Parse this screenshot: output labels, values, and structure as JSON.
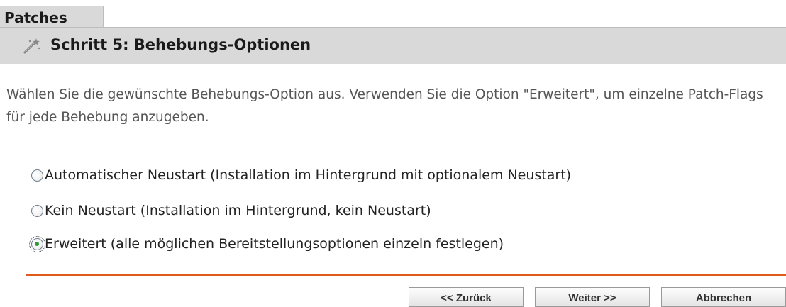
{
  "tab": {
    "label": "Patches"
  },
  "step": {
    "icon": "wizard-wand-icon",
    "title": "Schritt 5: Behebungs-Optionen"
  },
  "intro_text": "Wählen Sie die gewünschte Behebungs-Option aus. Verwenden Sie die Option \"Erweitert\", um einzelne Patch-Flags für jede Behebung anzugeben.",
  "options": [
    {
      "label": "Automatischer Neustart (Installation im Hintergrund mit optionalem Neustart)",
      "checked": false
    },
    {
      "label": "Kein Neustart (Installation im Hintergrund, kein Neustart)",
      "checked": false
    },
    {
      "label": "Erweitert (alle möglichen Bereitstellungsoptionen einzeln festlegen)",
      "checked": true
    }
  ],
  "buttons": {
    "back": "<< Zurück",
    "next": "Weiter >>",
    "cancel": "Abbrechen"
  },
  "colors": {
    "header_bg": "#d9d9d9",
    "divider": "#e05a1a",
    "radio_selected": "#2c9c3b"
  }
}
